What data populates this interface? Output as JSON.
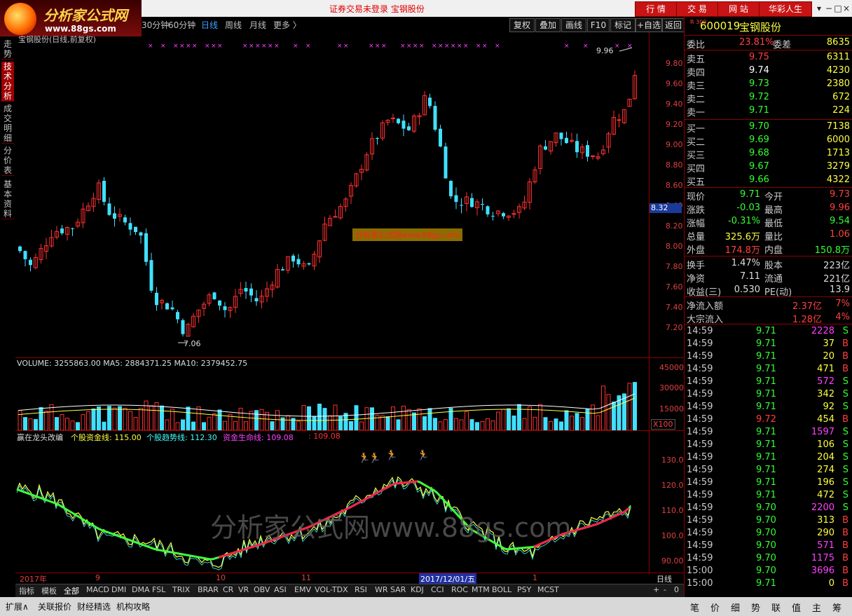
{
  "app": {
    "logo_text": "分析家公式网",
    "logo_url": "www.88gs.com",
    "status_text": "证券交易未登录   宝钢股份"
  },
  "top_buttons": [
    "行 情",
    "交 易",
    "网 站",
    "华彩人生"
  ],
  "window_controls": [
    "▾",
    "−",
    "□",
    "×"
  ],
  "periods": [
    "30分钟",
    "60分钟",
    "日线",
    "周线",
    "月线",
    "更多 〉"
  ],
  "active_period": "日线",
  "toolbar": [
    "复权",
    "叠加",
    "画线",
    "F10",
    "标记",
    "+自选",
    "返回"
  ],
  "left_nav": [
    "走势",
    "技术分析",
    "成交明细",
    "分价表",
    "基本资料"
  ],
  "main_chart": {
    "title": "宝钢股份(日线,前复权)",
    "price_axis": [
      "9.80",
      "9.60",
      "9.40",
      "9.20",
      "9.00",
      "8.80",
      "8.60",
      "8.40",
      "8.20",
      "8.00",
      "7.80",
      "7.60",
      "7.40",
      "7.20"
    ],
    "current_price_tag": "8.32",
    "high_label": "9.96",
    "low_label": "7.06",
    "watermark_label": "分析家公式网www.88gs.com"
  },
  "volume_panel": {
    "header": "VOLUME: 3255863.00  MA5: 2884371.25  MA10: 2379452.75",
    "axis": [
      "45000",
      "30000",
      "15000"
    ],
    "unit": "X100"
  },
  "indicator_panel": {
    "name": "赢在龙头改编",
    "line1": "个股资金线: 115.00",
    "line2": "个股趋势线: 112.30",
    "line3": "资金生命线: 109.08",
    "line4": ": 109.08",
    "axis": [
      "130.0",
      "120.0",
      "110.0",
      "100.0",
      "90.00"
    ],
    "watermark": "分析家公式网www.88gs.com"
  },
  "time_axis": {
    "labels": [
      "2017年",
      "9",
      "10",
      "11",
      "2017/12/01/五",
      "1"
    ],
    "period": "日线"
  },
  "indicator_tabs": [
    "指标",
    "模板",
    "全部",
    "MACD",
    "DMI",
    "DMA",
    "FSL",
    "TRIX",
    "BRAR",
    "CR",
    "VR",
    "OBV",
    "ASI",
    "EMV",
    "VOL-TDX",
    "RSI",
    "WR",
    "SAR",
    "KDJ",
    "CCI",
    "ROC",
    "MTM",
    "BOLL",
    "PSY",
    "MCST"
  ],
  "bottom_tabs": [
    "扩展∧",
    "关联报价",
    "财经精选",
    "机构攻略"
  ],
  "zoom_controls": [
    "+",
    "-",
    "0"
  ],
  "quote": {
    "code": "600019",
    "name": "宝钢股份",
    "market_badge": "R 300",
    "weibi_label": "委比",
    "weibi": "23.81%",
    "weicha_label": "委差",
    "weicha": "8635",
    "asks": [
      {
        "label": "卖五",
        "price": "9.75",
        "vol": "6311"
      },
      {
        "label": "卖四",
        "price": "9.74",
        "vol": "4230"
      },
      {
        "label": "卖三",
        "price": "9.73",
        "vol": "2380"
      },
      {
        "label": "卖二",
        "price": "9.72",
        "vol": "672"
      },
      {
        "label": "卖一",
        "price": "9.71",
        "vol": "224"
      }
    ],
    "bids": [
      {
        "label": "买一",
        "price": "9.70",
        "vol": "7138"
      },
      {
        "label": "买二",
        "price": "9.69",
        "vol": "6000"
      },
      {
        "label": "买三",
        "price": "9.68",
        "vol": "1713"
      },
      {
        "label": "买四",
        "price": "9.67",
        "vol": "3279"
      },
      {
        "label": "买五",
        "price": "9.66",
        "vol": "4322"
      }
    ],
    "stats": [
      {
        "l1": "现价",
        "v1": "9.71",
        "c1": "#33ff33",
        "l2": "今开",
        "v2": "9.73",
        "c2": "#ff4040"
      },
      {
        "l1": "涨跌",
        "v1": "-0.03",
        "c1": "#33ff33",
        "l2": "最高",
        "v2": "9.96",
        "c2": "#ff4040"
      },
      {
        "l1": "涨幅",
        "v1": "-0.31%",
        "c1": "#33ff33",
        "l2": "最低",
        "v2": "9.54",
        "c2": "#33ff33"
      },
      {
        "l1": "总量",
        "v1": "325.6万",
        "c1": "#ffff40",
        "l2": "量比",
        "v2": "1.06",
        "c2": "#ff4040"
      },
      {
        "l1": "外盘",
        "v1": "174.8万",
        "c1": "#ff4040",
        "l2": "内盘",
        "v2": "150.8万",
        "c2": "#33ff33"
      }
    ],
    "stats2": [
      {
        "l1": "换手",
        "v1": "1.47%",
        "l2": "股本",
        "v2": "223亿"
      },
      {
        "l1": "净资",
        "v1": "7.11",
        "l2": "流通",
        "v2": "221亿"
      },
      {
        "l1": "收益(三)",
        "v1": "0.530",
        "l2": "PE(动)",
        "v2": "13.9"
      }
    ],
    "flows": [
      {
        "label": "净流入额",
        "value": "2.37亿",
        "pct": "7%"
      },
      {
        "label": "大宗流入",
        "value": "1.28亿",
        "pct": "4%"
      }
    ],
    "ticks": [
      {
        "t": "14:59",
        "p": "9.71",
        "v": "2228",
        "s": "S",
        "vc": "#ff40ff"
      },
      {
        "t": "14:59",
        "p": "9.71",
        "v": "37",
        "s": "B",
        "vc": "#ffff40"
      },
      {
        "t": "14:59",
        "p": "9.71",
        "v": "20",
        "s": "B",
        "vc": "#ffff40"
      },
      {
        "t": "14:59",
        "p": "9.71",
        "v": "471",
        "s": "B",
        "vc": "#ffff40"
      },
      {
        "t": "14:59",
        "p": "9.71",
        "v": "572",
        "s": "S",
        "vc": "#ff40ff"
      },
      {
        "t": "14:59",
        "p": "9.71",
        "v": "342",
        "s": "S",
        "vc": "#ffff40"
      },
      {
        "t": "14:59",
        "p": "9.71",
        "v": "92",
        "s": "S",
        "vc": "#ffff40"
      },
      {
        "t": "14:59",
        "p": "9.72",
        "v": "454",
        "s": "B",
        "vc": "#ffff40"
      },
      {
        "t": "14:59",
        "p": "9.71",
        "v": "1597",
        "s": "S",
        "vc": "#ff40ff"
      },
      {
        "t": "14:59",
        "p": "9.71",
        "v": "106",
        "s": "S",
        "vc": "#ffff40"
      },
      {
        "t": "14:59",
        "p": "9.71",
        "v": "204",
        "s": "S",
        "vc": "#ffff40"
      },
      {
        "t": "14:59",
        "p": "9.71",
        "v": "274",
        "s": "S",
        "vc": "#ffff40"
      },
      {
        "t": "14:59",
        "p": "9.71",
        "v": "196",
        "s": "S",
        "vc": "#ffff40"
      },
      {
        "t": "14:59",
        "p": "9.71",
        "v": "472",
        "s": "S",
        "vc": "#ffff40"
      },
      {
        "t": "14:59",
        "p": "9.70",
        "v": "2200",
        "s": "S",
        "vc": "#ff40ff"
      },
      {
        "t": "14:59",
        "p": "9.70",
        "v": "313",
        "s": "B",
        "vc": "#ffff40"
      },
      {
        "t": "14:59",
        "p": "9.70",
        "v": "290",
        "s": "B",
        "vc": "#ffff40"
      },
      {
        "t": "14:59",
        "p": "9.70",
        "v": "571",
        "s": "B",
        "vc": "#ff40ff"
      },
      {
        "t": "14:59",
        "p": "9.70",
        "v": "1175",
        "s": "B",
        "vc": "#ff40ff"
      },
      {
        "t": "15:00",
        "p": "9.70",
        "v": "3696",
        "s": "B",
        "vc": "#ff40ff"
      },
      {
        "t": "15:00",
        "p": "9.71",
        "v": "0",
        "s": "B",
        "vc": "#ffff40"
      }
    ]
  },
  "right_tabs": [
    "笔",
    "价",
    "细",
    "势",
    "联",
    "值",
    "主",
    "筹"
  ]
}
